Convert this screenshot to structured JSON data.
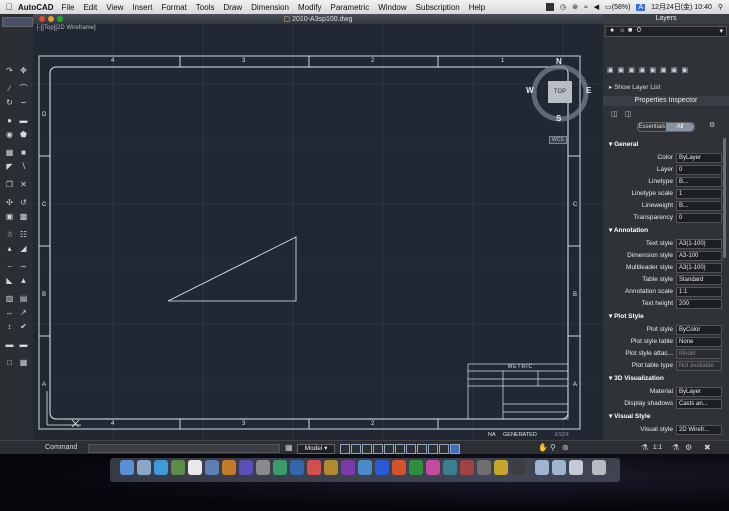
{
  "menubar": {
    "apple": "",
    "app": "AutoCAD",
    "items": [
      "File",
      "Edit",
      "View",
      "Insert",
      "Format",
      "Tools",
      "Draw",
      "Dimension",
      "Modify",
      "Parametric",
      "Window",
      "Subscription",
      "Help"
    ],
    "battery": "(58%)",
    "datetime": "12月24日(金) 10:40"
  },
  "window": {
    "title": "2010-A3sp100.dwg",
    "viewport_label": "[-][Top][2D Wireframe]"
  },
  "viewcube": {
    "north": "N",
    "south": "S",
    "east": "E",
    "west": "W",
    "face": "TOP",
    "wcs": "WCS"
  },
  "drawing": {
    "top_ticks": [
      "4",
      "3",
      "2",
      "1"
    ],
    "bottom_ticks": [
      "4",
      "3",
      "2",
      "1"
    ],
    "left_ticks": [
      "D",
      "C",
      "B",
      "A"
    ],
    "right_ticks": [
      "D",
      "C",
      "B",
      "A"
    ],
    "title_block": {
      "header": "METRIC",
      "note_a": "NA",
      "note_b": "GENERATED",
      "scale": "ESZ4"
    }
  },
  "layers_panel": {
    "title": "Layers",
    "current_layer": "0",
    "show_layer_list": "Show Layer List"
  },
  "properties": {
    "title": "Properties Inspector",
    "tabs": [
      "Essentials",
      "All"
    ],
    "active_tab": "All",
    "sections": {
      "general": "General",
      "annotation": "Annotation",
      "plot_style": "Plot Style",
      "viz3d": "3D Visualization",
      "visual_style": "Visual Style"
    },
    "rows": [
      {
        "label": "Color",
        "value": "ByLayer"
      },
      {
        "label": "Layer",
        "value": "0"
      },
      {
        "label": "Linetype",
        "value": "B..."
      },
      {
        "label": "Linetype scale",
        "value": "1"
      },
      {
        "label": "Lineweight",
        "value": "B..."
      },
      {
        "label": "Transparency",
        "value": "0"
      },
      {
        "label": "Text style",
        "value": "A3(1-100)"
      },
      {
        "label": "Dimension style",
        "value": "A3-100"
      },
      {
        "label": "Multileader style",
        "value": "A3(1-100)"
      },
      {
        "label": "Table style",
        "value": "Standard"
      },
      {
        "label": "Annotation scale",
        "value": "1:1"
      },
      {
        "label": "Text height",
        "value": "200"
      },
      {
        "label": "Plot style",
        "value": "ByColor"
      },
      {
        "label": "Plot style table",
        "value": "None"
      },
      {
        "label": "Plot style attac...",
        "value": "Model"
      },
      {
        "label": "Plot table type",
        "value": "Not available"
      },
      {
        "label": "Material",
        "value": "ByLayer"
      },
      {
        "label": "Display shadows",
        "value": "Casts an..."
      },
      {
        "label": "Visual style",
        "value": "2D Wirefr..."
      }
    ]
  },
  "status": {
    "command_label": "Command",
    "model": "Model",
    "scale": "1:1"
  }
}
